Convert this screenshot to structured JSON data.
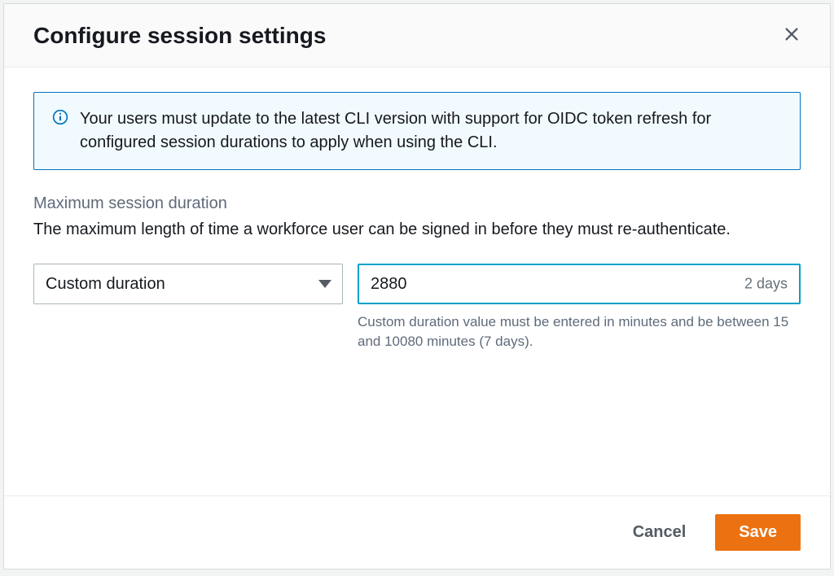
{
  "header": {
    "title": "Configure session settings"
  },
  "banner": {
    "text": "Your users must update to the latest CLI version with support for OIDC token refresh for configured session durations to apply when using the CLI."
  },
  "field": {
    "label": "Maximum session duration",
    "description": "The maximum length of time a workforce user can be signed in before they must re-authenticate.",
    "select_value": "Custom duration",
    "input_value": "2880",
    "input_suffix": "2 days",
    "help_text": "Custom duration value must be entered in minutes and be between 15 and 10080 minutes (7 days)."
  },
  "footer": {
    "cancel": "Cancel",
    "save": "Save"
  }
}
